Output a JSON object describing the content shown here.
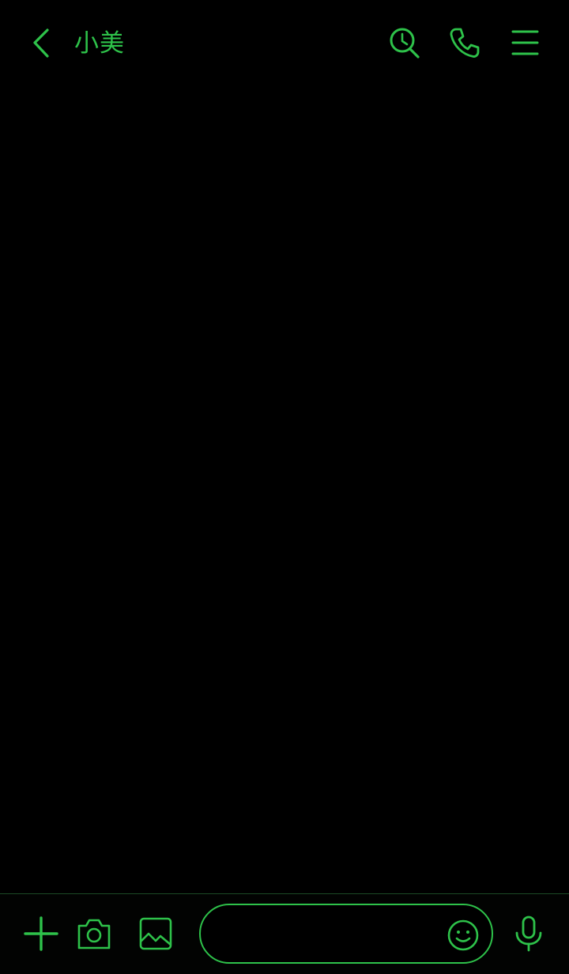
{
  "header": {
    "title": "小美",
    "back_icon": "chevron-left-icon",
    "history_icon": "search-history-icon",
    "call_icon": "phone-icon",
    "menu_icon": "hamburger-menu-icon"
  },
  "messages": [],
  "input_bar": {
    "message_value": "",
    "message_placeholder": "",
    "plus_icon": "plus-icon",
    "camera_icon": "camera-icon",
    "image_icon": "image-icon",
    "emoji_icon": "emoji-icon",
    "mic_icon": "microphone-icon"
  },
  "colors": {
    "accent": "#2ec24a",
    "background": "#000000"
  }
}
